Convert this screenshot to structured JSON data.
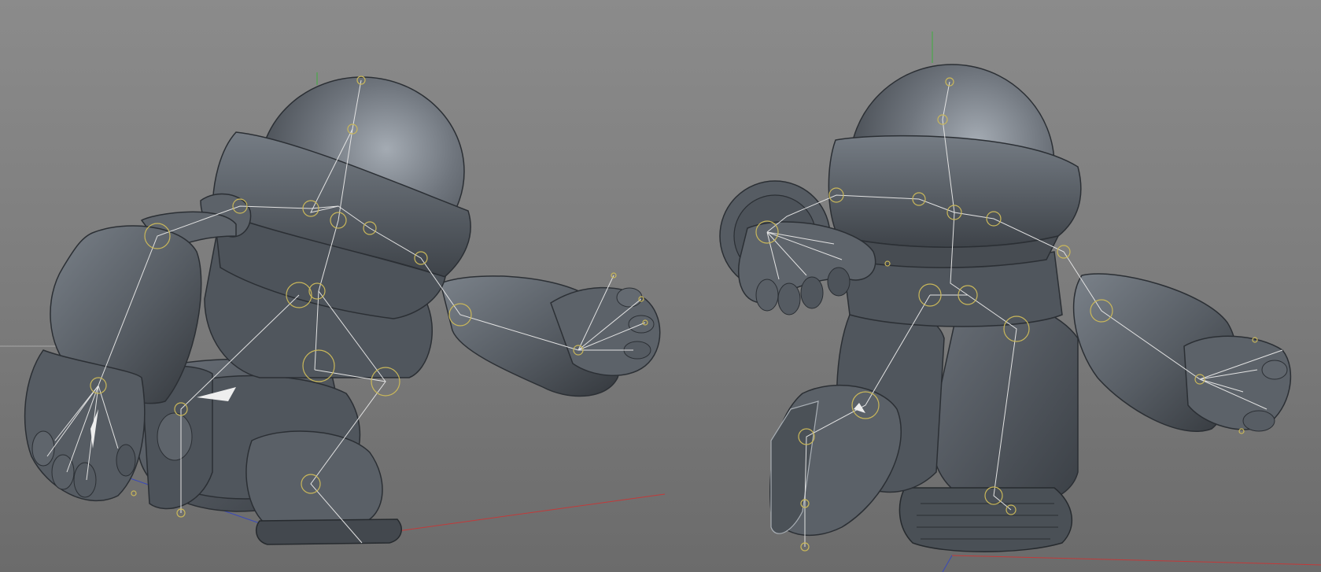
{
  "viewport": {
    "mode": "perspective",
    "shading": "gouraud",
    "colors": {
      "background_top": "#8a8a8a",
      "background_bottom": "#6d6d6d",
      "model": "#5b6066",
      "model_highlight": "#8e959d",
      "model_shadow": "#2d3136",
      "joint": "#c9b75a",
      "bone": "#e2e2e2",
      "axis_x": "#c23a3a",
      "axis_y": "#3fae3f",
      "axis_z": "#3a49b8"
    }
  },
  "scenes": [
    {
      "label": "",
      "icon": "rigged-character-side-view"
    },
    {
      "label": "",
      "icon": "rigged-character-three-quarter-view"
    }
  ]
}
